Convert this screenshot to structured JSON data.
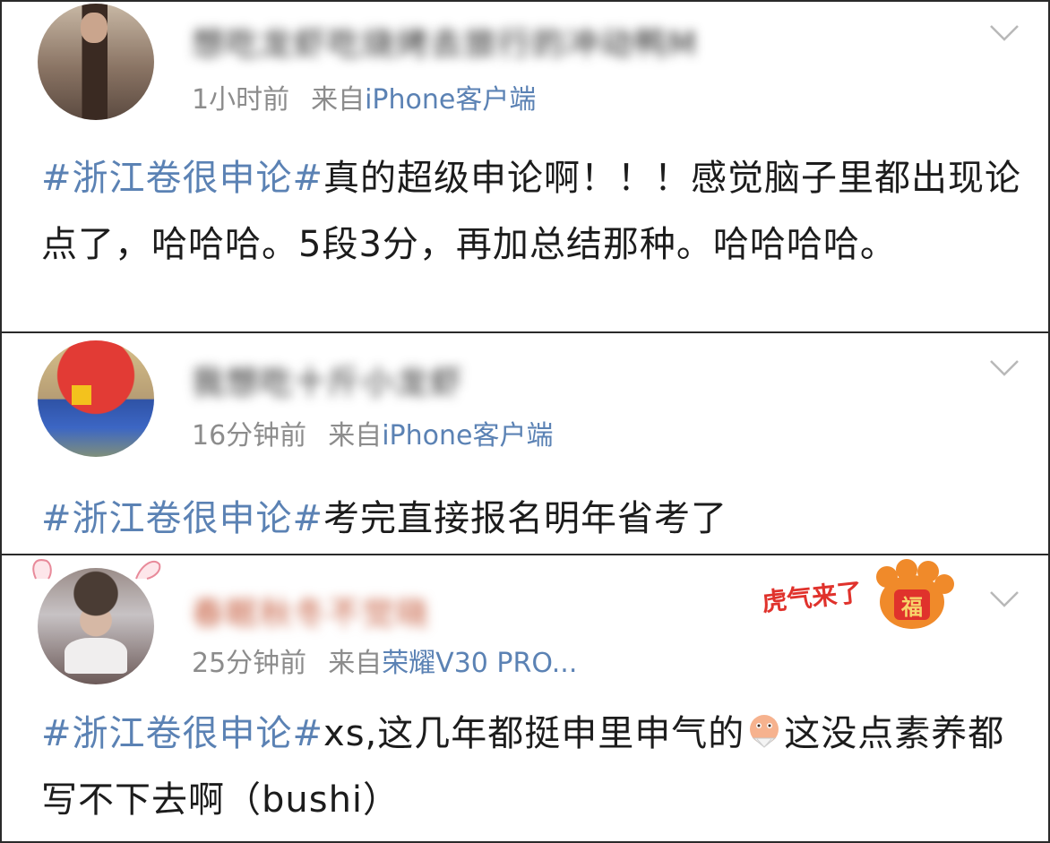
{
  "posts": [
    {
      "username": "想吃龙虾吃烧烤去旅行的冲动鸭M",
      "time": "1小时前",
      "source_prefix": "来自",
      "client": "iPhone客户端",
      "hashtag": "#浙江卷很申论#",
      "text": "真的超级申论啊！！！感觉脑子里都出现论点了，哈哈哈。5段3分，再加总结那种。哈哈哈哈。",
      "avatar_icon": "user-avatar-icon"
    },
    {
      "username": "我想吃十斤小龙虾",
      "time": "16分钟前",
      "source_prefix": "来自",
      "client": "iPhone客户端",
      "hashtag": "#浙江卷很申论#",
      "text": "考完直接报名明年省考了",
      "avatar_icon": "user-avatar-icon"
    },
    {
      "username": "春眠秋冬不觉晓",
      "time": "25分钟前",
      "source_prefix": "来自",
      "client": "荣耀V30 PRO...",
      "hashtag": "#浙江卷很申论#",
      "text_before_emoji": "xs,这几年都挺申里申气的",
      "emoji_icon": "fan-emoji-icon",
      "text_after_emoji": "这没点素养都写不下去啊（bushi）",
      "badge": "虎气来了",
      "badge_fu": "福",
      "avatar_icon": "user-avatar-icon"
    }
  ],
  "colors": {
    "link": "#5b82b4",
    "meta": "#8c8c8c",
    "text": "#1c1c1c",
    "border": "#2a2a2a"
  }
}
